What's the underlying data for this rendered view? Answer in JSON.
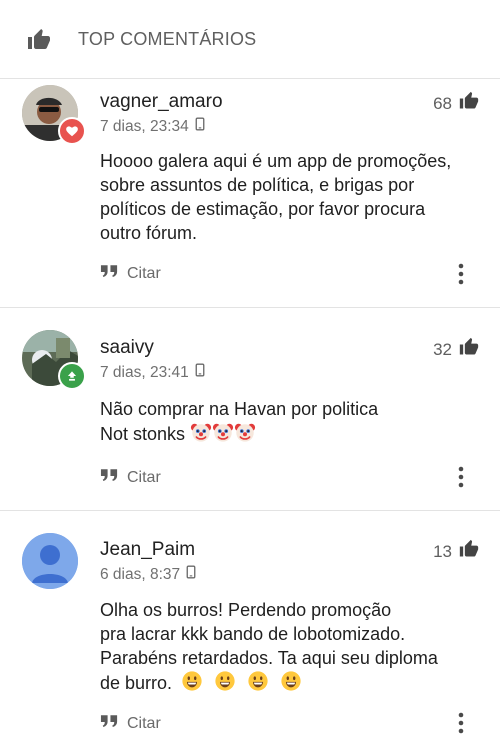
{
  "header": {
    "title": "TOP COMENTÁRIOS",
    "icon": "thumbs-up-icon"
  },
  "comments": [
    {
      "username": "vagner_amaro",
      "timestamp": "7 dias, 23:34",
      "likes": "68",
      "lines": [
        "Hoooo galera aqui é um app de promoções,",
        "sobre assuntos de política, e brigas por",
        "políticos de estimação, por favor procura",
        "outro fórum."
      ],
      "quote_label": "Citar",
      "badge": "heart-badge",
      "badge_color": "#e8534f"
    },
    {
      "username": "saaivy",
      "timestamp": "7 dias, 23:41",
      "likes": "32",
      "lines": [
        "Não comprar na Havan por politica",
        "Not stonks"
      ],
      "emojis": [
        "clown-face",
        "clown-face",
        "clown-face"
      ],
      "quote_label": "Citar",
      "badge": "level-up-badge",
      "badge_color": "#3aa14a"
    },
    {
      "username": "Jean_Paim",
      "timestamp": "6 dias, 8:37",
      "likes": "13",
      "lines": [
        "Olha os burros! Perdendo promoção",
        "pra lacrar kkk bando de lobotomizado.",
        "Parabéns retardados. Ta aqui seu diploma",
        "de burro."
      ],
      "emojis": [
        "grinning-face",
        "grinning-face",
        "grinning-face",
        "grinning-face"
      ],
      "quote_label": "Citar",
      "avatar_color": "#7ea8ea"
    }
  ],
  "colors": {
    "accent_text": "#5e5e5e",
    "divider": "#e3e3e3"
  }
}
